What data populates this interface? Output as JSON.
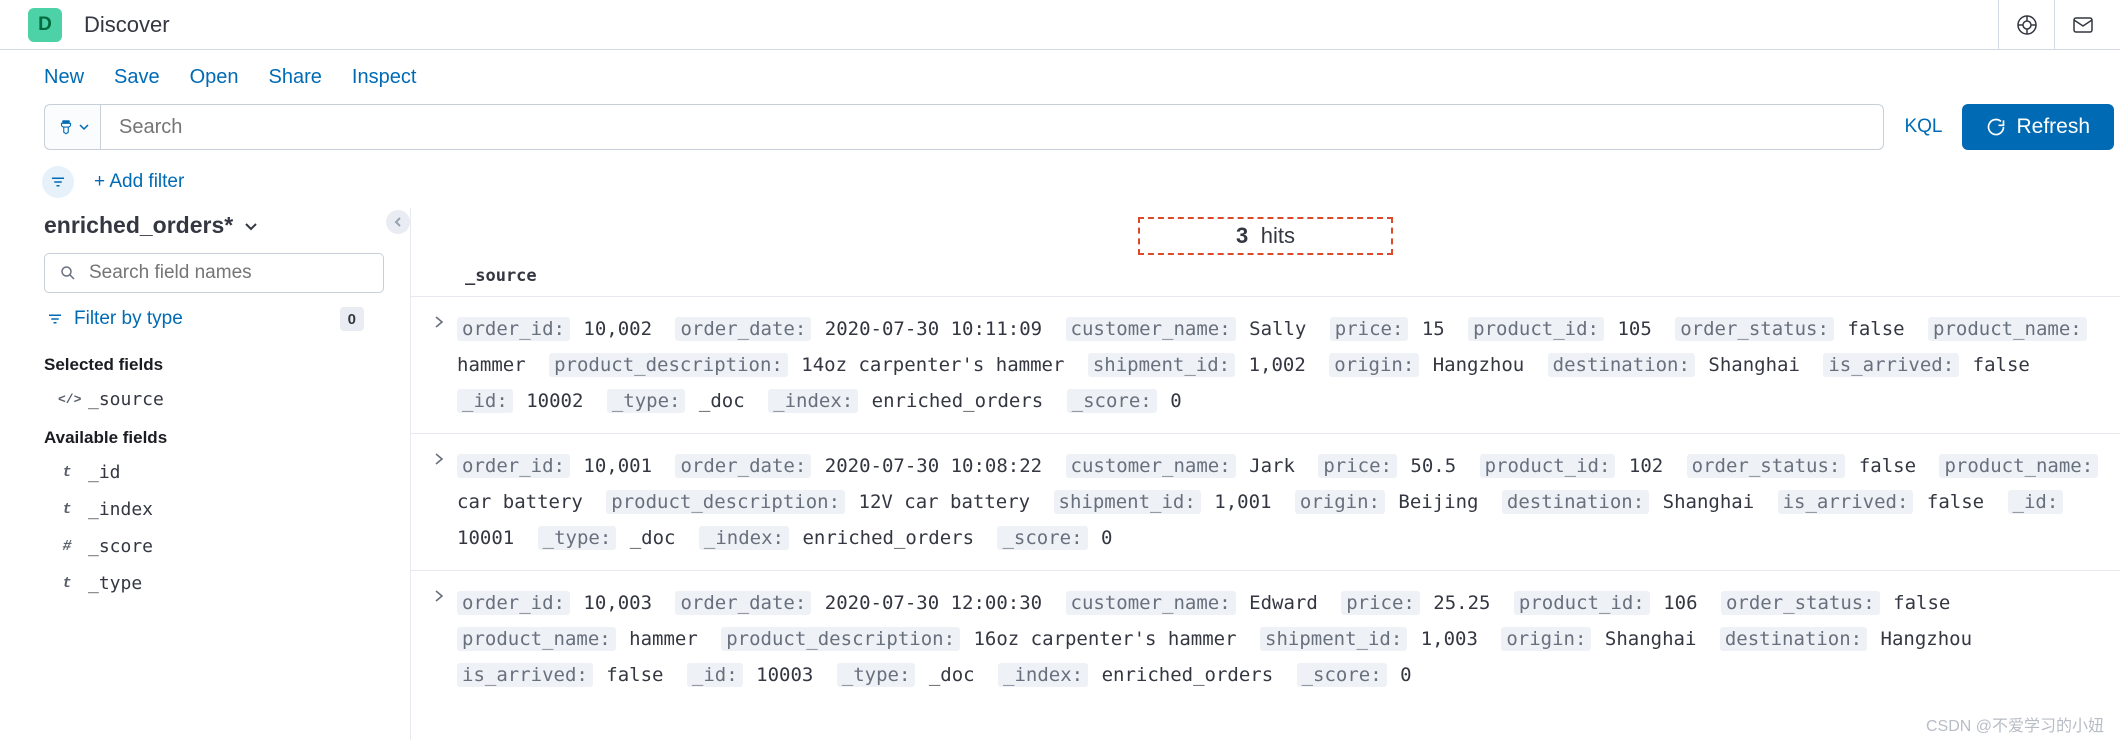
{
  "header": {
    "app_badge": "D",
    "app_title": "Discover"
  },
  "toolbar": [
    "New",
    "Save",
    "Open",
    "Share",
    "Inspect"
  ],
  "search": {
    "placeholder": "Search",
    "language": "KQL",
    "refresh": "Refresh"
  },
  "filters": {
    "add_label": "+ Add filter",
    "type_filter": "Filter by type",
    "type_count": "0"
  },
  "sidebar": {
    "index_pattern": "enriched_orders*",
    "field_search_placeholder": "Search field names",
    "selected_title": "Selected fields",
    "selected_fields": [
      {
        "type_icon": "</>",
        "name": "_source"
      }
    ],
    "available_title": "Available fields",
    "available_fields": [
      {
        "type_icon": "t",
        "name": "_id"
      },
      {
        "type_icon": "t",
        "name": "_index"
      },
      {
        "type_icon": "#",
        "name": "_score"
      },
      {
        "type_icon": "t",
        "name": "_type"
      }
    ]
  },
  "results": {
    "hits_count": "3",
    "hits_label": "hits",
    "column_header": "_source",
    "docs": [
      {
        "order_id": "10,002",
        "order_date": "2020-07-30 10:11:09",
        "customer_name": "Sally",
        "price": "15",
        "product_id": "105",
        "order_status": "false",
        "product_name": "hammer",
        "product_description": "14oz carpenter's hammer",
        "shipment_id": "1,002",
        "origin": "Hangzhou",
        "destination": "Shanghai",
        "is_arrived": "false",
        "_id": "10002",
        "_type": "_doc",
        "_index": "enriched_orders",
        "_score": "0"
      },
      {
        "order_id": "10,001",
        "order_date": "2020-07-30 10:08:22",
        "customer_name": "Jark",
        "price": "50.5",
        "product_id": "102",
        "order_status": "false",
        "product_name": "car battery",
        "product_description": "12V car battery",
        "shipment_id": "1,001",
        "origin": "Beijing",
        "destination": "Shanghai",
        "is_arrived": "false",
        "_id": "10001",
        "_type": "_doc",
        "_index": "enriched_orders",
        "_score": "0"
      },
      {
        "order_id": "10,003",
        "order_date": "2020-07-30 12:00:30",
        "customer_name": "Edward",
        "price": "25.25",
        "product_id": "106",
        "order_status": "false",
        "product_name": "hammer",
        "product_description": "16oz carpenter's hammer",
        "shipment_id": "1,003",
        "origin": "Shanghai",
        "destination": "Hangzhou",
        "is_arrived": "false",
        "_id": "10003",
        "_type": "_doc",
        "_index": "enriched_orders",
        "_score": "0"
      }
    ]
  },
  "doc_field_order": [
    "order_id",
    "order_date",
    "customer_name",
    "price",
    "product_id",
    "order_status",
    "product_name",
    "product_description",
    "shipment_id",
    "origin",
    "destination",
    "is_arrived",
    "_id",
    "_type",
    "_index",
    "_score"
  ],
  "watermark": "CSDN @不爱学习的小妞"
}
